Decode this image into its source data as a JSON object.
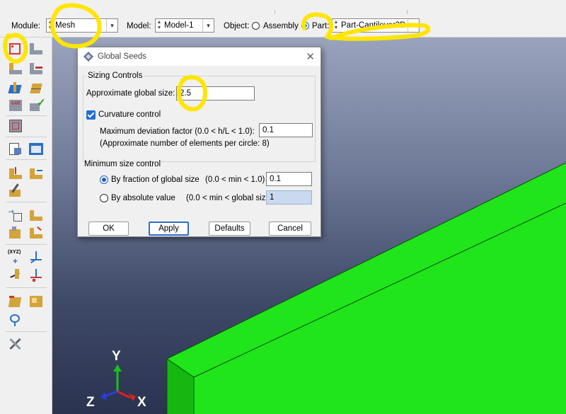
{
  "context_bar": {
    "module_label": "Module:",
    "module_value": "Mesh",
    "model_label": "Model:",
    "model_value": "Model-1",
    "object_label": "Object:",
    "assembly_label": "Assembly",
    "part_label": "Part:",
    "part_value": "Part-Cantilever3D",
    "selected_object": "Part"
  },
  "toolbox": {
    "tools": [
      "seed-part-icon",
      "seed-edges-icon",
      "assign-mesh-controls-icon",
      "seed-edge-biased-icon",
      "assign-element-type-icon",
      "mesh-part-icon",
      "verify-mesh-icon",
      "delete-mesh-icon",
      "mesh-region-icon",
      "query-info-icon",
      "mesh-stats-icon",
      "create-partition-icon",
      "partition-face-icon",
      "virtual-topology-icon",
      "edit-mesh-icon",
      "datum-icon",
      "create-datum-point-icon",
      "create-datum-axis-icon",
      "datum-csys-icon",
      "datum-plane-icon",
      "datum-point-on-line-icon",
      "offset-mesh-icon",
      "dependent-part-icon",
      "section-icon",
      "tools-icon"
    ]
  },
  "dialog": {
    "title": "Global Seeds",
    "sizing_controls_label": "Sizing Controls",
    "approx_size_label": "Approximate global size:",
    "approx_size_value": "2.5",
    "curvature_label": "Curvature control",
    "curvature_checked": true,
    "max_dev_label": "Maximum deviation factor (0.0 < h/L < 1.0):",
    "max_dev_value": "0.1",
    "approx_elements_note": "(Approximate number of elements per circle: 8)",
    "min_size_label": "Minimum size control",
    "by_fraction_label": "By fraction of global size",
    "by_fraction_range": "(0.0 < min < 1.0)",
    "by_fraction_value": "0.1",
    "by_absolute_label": "By absolute value",
    "by_absolute_range": "(0.0 < min < global size)",
    "by_absolute_value": "1",
    "selected_min_mode": "fraction",
    "buttons": {
      "ok": "OK",
      "apply": "Apply",
      "defaults": "Defaults",
      "cancel": "Cancel"
    }
  },
  "viewport": {
    "triad": {
      "y": "Y",
      "z": "Z",
      "x": "X"
    },
    "part_color": "#1fe51a",
    "part_color_dark": "#15b810",
    "background_top": "#9aa3bc",
    "background_bottom": "#2a3350"
  },
  "annotation_color": "#ffe500"
}
